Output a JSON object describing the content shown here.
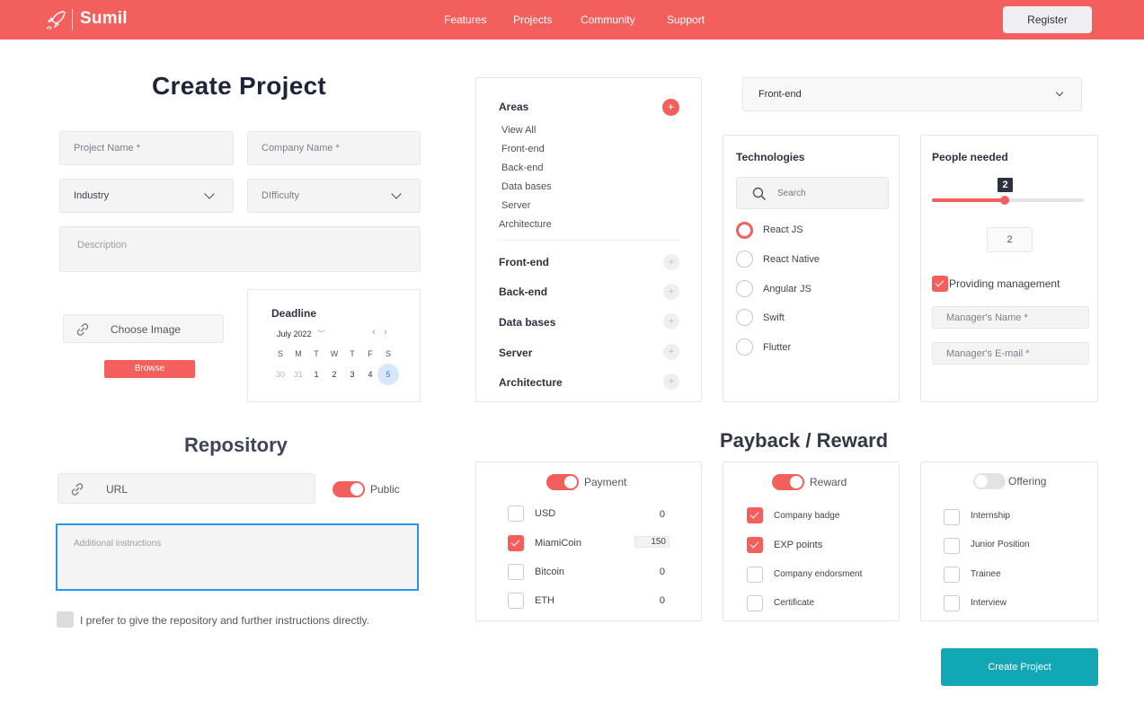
{
  "brand": {
    "name": "Sumil"
  },
  "nav": {
    "links": [
      "Features",
      "Projects",
      "Community",
      "Support"
    ],
    "register": "Register"
  },
  "form": {
    "title": "Create Project",
    "project_name": "Project Name *",
    "company_name": "Company Name *",
    "industry": "Industry",
    "difficulty": "DIfficulty",
    "description": "Description",
    "choose_image": "Choose Image",
    "browse": "Browse"
  },
  "deadline": {
    "label": "Deadline",
    "month": "July 2022",
    "weekdays": [
      "S",
      "M",
      "T",
      "W",
      "T",
      "F",
      "S"
    ],
    "days": [
      "30",
      "31",
      "1",
      "2",
      "3",
      "4",
      "5"
    ],
    "selected_day": "5"
  },
  "areas": {
    "title": "Areas",
    "sub_items": [
      "View All",
      "Front-end",
      "Back-end",
      "Data bases",
      "Server",
      "Architecture"
    ],
    "groups": [
      "Front-end",
      "Back-end",
      "Data bases",
      "Server",
      "Architecture"
    ]
  },
  "area_select": {
    "value": "Front-end"
  },
  "technologies": {
    "title": "Technologies",
    "search_placeholder": "Search",
    "options": [
      "React JS",
      "React Native",
      "Angular JS",
      "Swift",
      "Flutter"
    ],
    "selected": "React JS"
  },
  "people": {
    "title": "People needed",
    "slider_value": "2",
    "count": "2",
    "providing_management": "Providing management",
    "manager_name": "Manager's Name *",
    "manager_email": "Manager's E-mail *"
  },
  "repository": {
    "title": "Repository",
    "url_placeholder": "URL",
    "public_label": "Public",
    "instructions_placeholder": "Additional instructions",
    "direct_label": "I prefer to give the repository and further instructions directly."
  },
  "payback": {
    "title": "Payback / Reward",
    "payment": {
      "label": "Payment",
      "items": [
        {
          "name": "USD",
          "amount": "0",
          "checked": false
        },
        {
          "name": "MiamiCoin",
          "amount": "150",
          "checked": true
        },
        {
          "name": "Bitcoin",
          "amount": "0",
          "checked": false
        },
        {
          "name": "ETH",
          "amount": "0",
          "checked": false
        }
      ]
    },
    "reward": {
      "label": "Reward",
      "items": [
        {
          "name": "Company badge",
          "checked": true
        },
        {
          "name": "EXP points",
          "checked": true
        },
        {
          "name": "Company endorsment",
          "checked": false
        },
        {
          "name": "Certificate",
          "checked": false
        }
      ]
    },
    "offering": {
      "label": "Offering",
      "items": [
        {
          "name": "Internship",
          "checked": false
        },
        {
          "name": "Junior Position",
          "checked": false
        },
        {
          "name": "Trainee",
          "checked": false
        },
        {
          "name": "Interview",
          "checked": false
        }
      ]
    }
  },
  "actions": {
    "create": "Create Project"
  },
  "colors": {
    "primary": "#f25f5c",
    "accent": "#12a7b4",
    "focus": "#2196f3"
  }
}
